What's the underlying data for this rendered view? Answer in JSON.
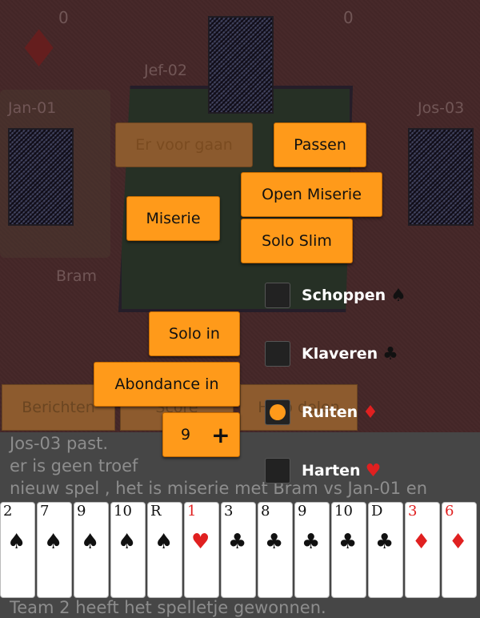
{
  "scores": {
    "left": "0",
    "right": "0"
  },
  "trump_suit_icon": "diamond",
  "players": {
    "top": "Jef-02",
    "left": "Jan-01",
    "right": "Jos-03",
    "bottom": "Bram"
  },
  "buttons": {
    "er_voor_gaan": "Er voor gaan",
    "passen": "Passen",
    "open_miserie": "Open Miserie",
    "miserie": "Miserie",
    "solo_slim": "Solo Slim",
    "solo_in": "Solo in",
    "abondance_in": "Abondance in",
    "stepper_value": "9",
    "stepper_plus": "+"
  },
  "bottom_bar": {
    "berichten": "Berichten",
    "score": "Score",
    "hulp": "Hulp",
    "delen": "delen"
  },
  "suits": [
    {
      "label": "Schoppen",
      "symbol": "♠",
      "color": "#111111",
      "selected": false
    },
    {
      "label": "Klaveren",
      "symbol": "♣",
      "color": "#111111",
      "selected": false
    },
    {
      "label": "Ruiten",
      "symbol": "♦",
      "color": "#e02020",
      "selected": true
    },
    {
      "label": "Harten",
      "symbol": "♥",
      "color": "#e02020",
      "selected": false
    }
  ],
  "log": [
    "Jos-03 past.",
    "er is geen troef",
    "nieuw spel , het is miserie met  Bram  vs  Jan-01  en",
    "Team 2 heeft het spelletje gewonnen."
  ],
  "hand": [
    {
      "rank": "2",
      "suit": "♠",
      "color": "black"
    },
    {
      "rank": "7",
      "suit": "♠",
      "color": "black"
    },
    {
      "rank": "9",
      "suit": "♠",
      "color": "black"
    },
    {
      "rank": "10",
      "suit": "♠",
      "color": "black"
    },
    {
      "rank": "R",
      "suit": "♠",
      "color": "black"
    },
    {
      "rank": "1",
      "suit": "♥",
      "color": "red"
    },
    {
      "rank": "3",
      "suit": "♣",
      "color": "black"
    },
    {
      "rank": "8",
      "suit": "♣",
      "color": "black"
    },
    {
      "rank": "9",
      "suit": "♣",
      "color": "black"
    },
    {
      "rank": "10",
      "suit": "♣",
      "color": "black"
    },
    {
      "rank": "D",
      "suit": "♣",
      "color": "black"
    },
    {
      "rank": "3",
      "suit": "♦",
      "color": "red"
    },
    {
      "rank": "6",
      "suit": "♦",
      "color": "red"
    }
  ]
}
